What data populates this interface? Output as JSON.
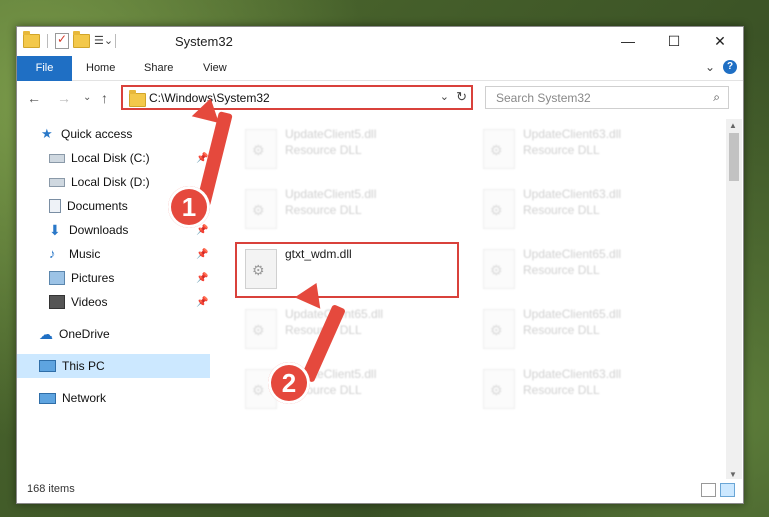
{
  "window": {
    "title": "System32"
  },
  "titlebar": {
    "minimize": "—",
    "maximize": "☐",
    "close": "✕"
  },
  "ribbon": {
    "tabs": [
      "File",
      "Home",
      "Share",
      "View"
    ],
    "expand": "⌄",
    "help": "?"
  },
  "nav": {
    "back": "←",
    "forward": "→",
    "recent": "⌄",
    "up": "↑"
  },
  "address": {
    "path": "C:\\Windows\\System32",
    "dropdown": "⌄",
    "refresh": "↻"
  },
  "search": {
    "placeholder": "Search System32",
    "icon": "⌕"
  },
  "sidebar": {
    "items": [
      {
        "label": "Quick access",
        "icon": "star-icon"
      },
      {
        "label": "Local Disk (C:)",
        "icon": "drive-icon"
      },
      {
        "label": "Local Disk (D:)",
        "icon": "drive-icon"
      },
      {
        "label": "Documents",
        "icon": "documents-icon"
      },
      {
        "label": "Downloads",
        "icon": "download-icon"
      },
      {
        "label": "Music",
        "icon": "music-icon"
      },
      {
        "label": "Pictures",
        "icon": "pictures-icon"
      },
      {
        "label": "Videos",
        "icon": "videos-icon"
      },
      {
        "label": "OneDrive",
        "icon": "cloud-icon"
      },
      {
        "label": "This PC",
        "icon": "computer-icon"
      },
      {
        "label": "Network",
        "icon": "network-icon"
      }
    ]
  },
  "files": {
    "blurred": [
      {
        "name": "UpdateClient5.dll",
        "type": "Resource DLL"
      },
      {
        "name": "UpdateClient63.dll",
        "type": "Resource DLL"
      },
      {
        "name": "UpdateClient5.dll",
        "type": "Resource DLL"
      },
      {
        "name": "UpdateClient63.dll",
        "type": "Resource DLL"
      },
      {
        "name": "UpdateClient65.dll",
        "type": "Resource DLL"
      },
      {
        "name": "UpdateClient65.dll",
        "type": "Resource DLL"
      },
      {
        "name": "UpdateClient65.dll",
        "type": "Resource DLL"
      },
      {
        "name": "UpdateClient5.dll",
        "type": "Resource DLL"
      },
      {
        "name": "UpdateClient63.dll",
        "type": "Resource DLL"
      }
    ],
    "highlighted": {
      "name": "gtxt_wdm.dll"
    }
  },
  "annotations": {
    "step1": "1",
    "step2": "2",
    "color": "#e5493d"
  },
  "status": {
    "count": "168 items"
  },
  "colors": {
    "accent": "#1f6fc4",
    "selection": "#cce8ff",
    "highlight": "#d9413b"
  }
}
